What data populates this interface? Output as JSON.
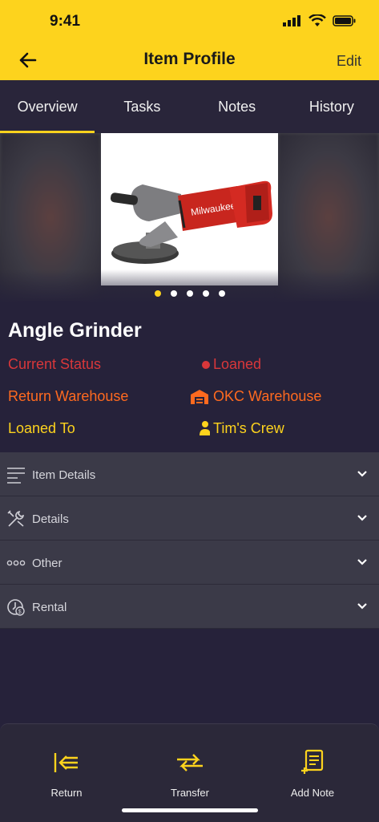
{
  "status_bar": {
    "time": "9:41"
  },
  "header": {
    "title": "Item Profile",
    "edit_label": "Edit",
    "accent_color": "#fdd31d"
  },
  "tabs": [
    {
      "label": "Overview",
      "active": true
    },
    {
      "label": "Tasks",
      "active": false
    },
    {
      "label": "Notes",
      "active": false
    },
    {
      "label": "History",
      "active": false
    }
  ],
  "gallery": {
    "image_icon": "angle-grinder-photo",
    "total_images": 5,
    "active_index": 0
  },
  "item": {
    "name": "Angle Grinder",
    "status": {
      "label": "Current Status",
      "value": "Loaned",
      "color": "#d8373a",
      "icon": "dot-icon"
    },
    "return_warehouse": {
      "label": "Return Warehouse",
      "value": "OKC Warehouse",
      "color": "#ff6a1f",
      "icon": "warehouse-icon"
    },
    "loaned_to": {
      "label": "Loaned To",
      "value": "Tim's Crew",
      "color": "#fdd31d",
      "icon": "person-icon"
    }
  },
  "sections": [
    {
      "label": "Item Details",
      "icon": "lines-icon"
    },
    {
      "label": "Details",
      "icon": "tools-icon"
    },
    {
      "label": "Other",
      "icon": "dots-icon"
    },
    {
      "label": "Rental",
      "icon": "clock-dollar-icon"
    }
  ],
  "actions": [
    {
      "label": "Return",
      "icon": "return-icon"
    },
    {
      "label": "Transfer",
      "icon": "transfer-icon"
    },
    {
      "label": "Add Note",
      "icon": "add-note-icon"
    }
  ]
}
